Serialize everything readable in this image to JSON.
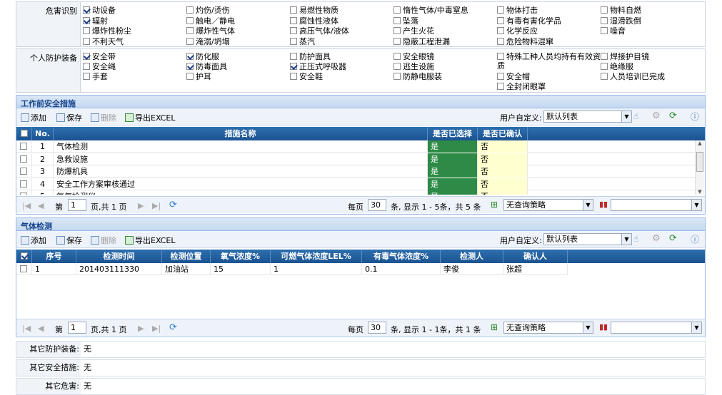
{
  "hazard": {
    "label": "危害识别",
    "options": [
      {
        "text": "动设备",
        "checked": true
      },
      {
        "text": "灼伤/烫伤",
        "checked": false
      },
      {
        "text": "易燃性物质",
        "checked": false
      },
      {
        "text": "惰性气体/中毒窒息",
        "checked": false
      },
      {
        "text": "物体打击",
        "checked": false
      },
      {
        "text": "物料自燃",
        "checked": false
      },
      {
        "text": "辐射",
        "checked": true
      },
      {
        "text": "触电／静电",
        "checked": false
      },
      {
        "text": "腐蚀性液体",
        "checked": false
      },
      {
        "text": "坠落",
        "checked": false
      },
      {
        "text": "有毒有害化学品",
        "checked": false
      },
      {
        "text": "湿滑跌倒",
        "checked": false
      },
      {
        "text": "爆炸性粉尘",
        "checked": false
      },
      {
        "text": "爆炸性气体",
        "checked": false
      },
      {
        "text": "高压气体/液体",
        "checked": false
      },
      {
        "text": "产生火花",
        "checked": false
      },
      {
        "text": "化学反应",
        "checked": false
      },
      {
        "text": "噪音",
        "checked": false
      },
      {
        "text": "不利天气",
        "checked": false
      },
      {
        "text": "淹溺/坍塌",
        "checked": false
      },
      {
        "text": "蒸汽",
        "checked": false
      },
      {
        "text": "隐蔽工程泄漏",
        "checked": false
      },
      {
        "text": "危险物料混窜",
        "checked": false
      }
    ]
  },
  "ppe": {
    "label": "个人防护装备",
    "options": [
      {
        "text": "安全带",
        "checked": true
      },
      {
        "text": "防化服",
        "checked": true
      },
      {
        "text": "防护面具",
        "checked": false
      },
      {
        "text": "安全眼镜",
        "checked": false
      },
      {
        "text": "特殊工种人员均持有有效资",
        "checked": false
      },
      {
        "text": "焊接护目镜",
        "checked": false
      },
      {
        "text": "安全绳",
        "checked": false
      },
      {
        "text": "防毒面具",
        "checked": true
      },
      {
        "text": "正压式呼吸器",
        "checked": true
      },
      {
        "text": "逃生设施",
        "checked": false
      },
      {
        "text": "绝缘服",
        "checked": false
      },
      {
        "text": "手套",
        "checked": false
      },
      {
        "text": "护耳",
        "checked": false
      },
      {
        "text": "安全鞋",
        "checked": false
      },
      {
        "text": "防静电服装",
        "checked": false
      },
      {
        "text": "安全帽",
        "checked": false
      },
      {
        "text": "人员培训已完成",
        "checked": false
      },
      {
        "text": "全封闭眼罩",
        "checked": false
      }
    ],
    "wrap_suffix": "质"
  },
  "measures": {
    "title": "工作前安全措施",
    "toolbar": {
      "add": "添加",
      "save": "保存",
      "delete": "删除",
      "export": "导出EXCEL",
      "custom_label": "用户自定义:",
      "custom_value": "默认列表"
    },
    "columns": [
      "No.",
      "措施名称",
      "是否已选择",
      "是否已确认"
    ],
    "rows": [
      {
        "no": "1",
        "name": "气体检测",
        "selected": "是",
        "confirmed": "否"
      },
      {
        "no": "2",
        "name": "急救设施",
        "selected": "是",
        "confirmed": "否"
      },
      {
        "no": "3",
        "name": "防爆机具",
        "selected": "是",
        "confirmed": "否"
      },
      {
        "no": "4",
        "name": "安全工作方案审核通过",
        "selected": "是",
        "confirmed": "否"
      },
      {
        "no": "5",
        "name": "氧气检测仪",
        "selected": "是",
        "confirmed": "否"
      }
    ],
    "pager": {
      "first": "第",
      "page": "1",
      "total": "页,共 1 页",
      "per_label": "每页",
      "per": "30",
      "info": "条, 显示 1 - 5条，共 5 条",
      "strategy": "无查询策略"
    }
  },
  "gas": {
    "title": "气体检测",
    "toolbar": {
      "add": "添加",
      "save": "保存",
      "delete": "删除",
      "export": "导出EXCEL",
      "custom_label": "用户自定义:",
      "custom_value": "默认列表"
    },
    "columns": [
      "序号",
      "检测时间",
      "检测位置",
      "氧气浓度%",
      "可燃气体浓度LEL%",
      "有毒气体浓度%",
      "检测人",
      "确认人"
    ],
    "rows": [
      {
        "no": "1",
        "time": "201403111330",
        "loc": "加油站",
        "o2": "15",
        "lel": "1",
        "toxic": "0.1",
        "tester": "李俊",
        "confirmer": "张超"
      }
    ],
    "pager": {
      "first": "第",
      "page": "1",
      "total": "页,共 1 页",
      "per_label": "每页",
      "per": "30",
      "info": "条, 显示 1 - 1条，共 1 条",
      "strategy": "无查询策略"
    }
  },
  "other": {
    "ppe_label": "其它防护装备:",
    "ppe_value": "无",
    "measure_label": "其它安全措施:",
    "measure_value": "无",
    "hazard_label": "其它危害:",
    "hazard_value": "无"
  }
}
